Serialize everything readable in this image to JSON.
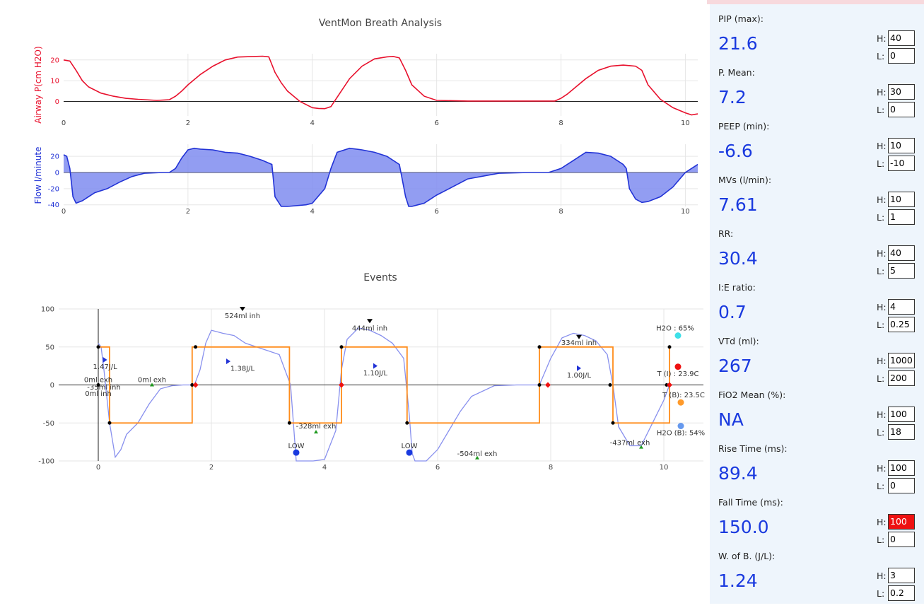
{
  "chart_data": [
    {
      "type": "line",
      "title": "VentMon Breath Analysis",
      "ylabel": "Airway P(cm H2O)",
      "xlim": [
        0,
        10.2
      ],
      "ylim": [
        -7,
        23
      ],
      "xticks": [
        0,
        2,
        4,
        6,
        8,
        10
      ],
      "yticks": [
        0,
        10,
        20
      ],
      "color": "#e8112d",
      "x": [
        0,
        0.1,
        0.2,
        0.3,
        0.4,
        0.6,
        0.8,
        1.0,
        1.2,
        1.5,
        1.7,
        1.8,
        1.9,
        2.0,
        2.2,
        2.4,
        2.6,
        2.8,
        3.0,
        3.2,
        3.3,
        3.4,
        3.5,
        3.6,
        3.8,
        4.0,
        4.1,
        4.2,
        4.3,
        4.4,
        4.6,
        4.8,
        5.0,
        5.2,
        5.3,
        5.4,
        5.5,
        5.6,
        5.8,
        6.0,
        6.5,
        7.0,
        7.5,
        7.9,
        8.0,
        8.1,
        8.2,
        8.4,
        8.6,
        8.8,
        9.0,
        9.2,
        9.3,
        9.4,
        9.6,
        9.8,
        10.0,
        10.1,
        10.2
      ],
      "y": [
        20,
        19.5,
        15,
        10,
        7,
        4,
        2.5,
        1.5,
        1,
        0.5,
        0.8,
        2.5,
        5,
        8,
        13,
        17,
        20,
        21.4,
        21.6,
        21.8,
        21.5,
        14,
        9,
        5,
        0,
        -3,
        -3.4,
        -3.5,
        -2.5,
        2,
        11,
        17,
        20.5,
        21.5,
        21.7,
        21,
        15,
        8,
        2.5,
        0.5,
        0.2,
        0.2,
        0.2,
        0.2,
        1.5,
        3.5,
        6,
        11,
        15,
        17,
        17.5,
        17,
        15,
        8,
        1,
        -3,
        -5.5,
        -6.5,
        -6
      ]
    },
    {
      "type": "area",
      "ylabel": "Flow l/minute",
      "xlim": [
        0,
        10.2
      ],
      "ylim": [
        -42,
        35
      ],
      "xticks": [
        0,
        2,
        4,
        6,
        8,
        10
      ],
      "yticks": [
        -40,
        -20,
        0,
        20
      ],
      "color": "#2233d6",
      "x": [
        0,
        0.05,
        0.1,
        0.15,
        0.2,
        0.3,
        0.5,
        0.7,
        0.9,
        1.1,
        1.3,
        1.6,
        1.7,
        1.8,
        1.9,
        2.0,
        2.1,
        2.2,
        2.4,
        2.6,
        2.8,
        3.0,
        3.2,
        3.35,
        3.4,
        3.5,
        3.6,
        3.9,
        4.0,
        4.2,
        4.3,
        4.4,
        4.6,
        4.8,
        5.0,
        5.2,
        5.4,
        5.5,
        5.55,
        5.6,
        5.7,
        5.8,
        6.0,
        6.2,
        6.5,
        7.0,
        7.5,
        7.8,
        8.0,
        8.2,
        8.4,
        8.6,
        8.8,
        9.0,
        9.05,
        9.1,
        9.2,
        9.3,
        9.4,
        9.6,
        9.8,
        10.0,
        10.2
      ],
      "y": [
        22,
        20,
        5,
        -30,
        -38,
        -35,
        -25,
        -20,
        -12,
        -5,
        -1,
        0,
        0,
        5,
        18,
        28,
        30,
        29,
        28,
        25,
        24,
        20,
        15,
        10,
        -30,
        -42,
        -42,
        -40,
        -38,
        -20,
        5,
        25,
        30,
        28,
        25,
        20,
        10,
        -30,
        -42,
        -42,
        -40,
        -38,
        -28,
        -20,
        -8,
        -1,
        0,
        0,
        5,
        15,
        25,
        24,
        20,
        10,
        5,
        -20,
        -33,
        -37,
        -36,
        -30,
        -18,
        0,
        10
      ]
    },
    {
      "type": "scatter",
      "title": "Events",
      "xlim": [
        -0.7,
        10.7
      ],
      "ylim": [
        -100,
        100
      ],
      "xticks": [
        0,
        2,
        4,
        6,
        8,
        10
      ],
      "yticks": [
        -100,
        -50,
        0,
        50,
        100
      ],
      "series": [
        {
          "color": "#8890ee",
          "x": [
            0,
            0.05,
            0.1,
            0.2,
            0.3,
            0.4,
            0.5,
            0.7,
            0.9,
            1.1,
            1.3,
            1.5,
            1.7,
            1.8,
            1.9,
            2.0,
            2.2,
            2.4,
            2.6,
            2.8,
            3.0,
            3.2,
            3.4,
            3.5,
            3.6,
            3.8,
            4.0,
            4.2,
            4.3,
            4.4,
            4.6,
            4.8,
            5.0,
            5.2,
            5.4,
            5.5,
            5.55,
            5.6,
            5.8,
            6.0,
            6.2,
            6.4,
            6.6,
            7.0,
            7.4,
            7.8,
            8.0,
            8.2,
            8.4,
            8.6,
            8.8,
            9.0,
            9.1,
            9.2,
            9.4,
            9.6,
            9.8,
            10.0,
            10.1
          ],
          "y": [
            55,
            50,
            20,
            -50,
            -95,
            -85,
            -65,
            -50,
            -25,
            -5,
            -1,
            0,
            0,
            20,
            55,
            72,
            68,
            65,
            55,
            50,
            45,
            40,
            0,
            -100,
            -100,
            -100,
            -98,
            -60,
            20,
            60,
            75,
            72,
            65,
            55,
            35,
            -40,
            -90,
            -100,
            -100,
            -85,
            -60,
            -35,
            -15,
            -1,
            0,
            0,
            35,
            62,
            68,
            65,
            58,
            40,
            0,
            -55,
            -80,
            -80,
            -50,
            -20,
            0
          ]
        },
        {
          "color": "#ff8c1a",
          "x": [
            0,
            0.2,
            0.2,
            1.66,
            1.66,
            3.38,
            3.38,
            4.3,
            4.3,
            5.46,
            5.46,
            7.8,
            7.8,
            9.1,
            9.1,
            10.1,
            10.1
          ],
          "y": [
            50,
            50,
            -50,
            -50,
            50,
            50,
            -50,
            -50,
            50,
            50,
            -50,
            -50,
            50,
            50,
            -50,
            -50,
            50
          ]
        }
      ],
      "labels": [
        {
          "text": "524ml inh",
          "x": 2.55,
          "y": 91
        },
        {
          "text": "444ml inh",
          "x": 4.8,
          "y": 75
        },
        {
          "text": "334ml inh",
          "x": 8.5,
          "y": 56
        },
        {
          "text": "1.47J/L",
          "x": 0.12,
          "y": 24
        },
        {
          "text": "1.38J/L",
          "x": 2.55,
          "y": 22
        },
        {
          "text": "1.10J/L",
          "x": 4.9,
          "y": 16
        },
        {
          "text": "1.00J/L",
          "x": 8.5,
          "y": 13
        },
        {
          "text": "0ml exh",
          "x": 0,
          "y": 7
        },
        {
          "text": "0ml exh",
          "x": 0.95,
          "y": 7
        },
        {
          "text": "-35ml inh",
          "x": 0.1,
          "y": -3
        },
        {
          "text": "0ml inh",
          "x": 0,
          "y": -11
        },
        {
          "text": "-328ml exh",
          "x": 3.85,
          "y": -54
        },
        {
          "text": "-504ml exh",
          "x": 6.7,
          "y": -90
        },
        {
          "text": "-437ml exh",
          "x": 9.4,
          "y": -76
        },
        {
          "text": "LOW",
          "x": 3.5,
          "y": -80
        },
        {
          "text": "LOW",
          "x": 5.5,
          "y": -80
        },
        {
          "text": "H2O : 65%",
          "x": 10.2,
          "y": 75
        },
        {
          "text": "T (I) : 23.9C",
          "x": 10.25,
          "y": 15
        },
        {
          "text": "T (B): 23.5C",
          "x": 10.35,
          "y": -13
        },
        {
          "text": "H2O (B): 54%",
          "x": 10.3,
          "y": -63
        }
      ],
      "markers": [
        {
          "shape": "tri-down",
          "color": "#000000",
          "x": 2.55,
          "y": 100
        },
        {
          "shape": "tri-down",
          "color": "#000000",
          "x": 4.8,
          "y": 84
        },
        {
          "shape": "tri-down",
          "color": "#000000",
          "x": 8.5,
          "y": 63
        },
        {
          "shape": "tri-right",
          "color": "#2233d6",
          "x": 0.12,
          "y": 33
        },
        {
          "shape": "tri-right",
          "color": "#2233d6",
          "x": 2.3,
          "y": 31
        },
        {
          "shape": "tri-right",
          "color": "#2233d6",
          "x": 4.9,
          "y": 25
        },
        {
          "shape": "tri-right",
          "color": "#2233d6",
          "x": 8.5,
          "y": 22
        },
        {
          "shape": "tri-up",
          "color": "#1f9a1f",
          "x": 0.95,
          "y": 0
        },
        {
          "shape": "tri-up",
          "color": "#1f9a1f",
          "x": 3.85,
          "y": -62
        },
        {
          "shape": "tri-up",
          "color": "#1f9a1f",
          "x": 6.7,
          "y": -96
        },
        {
          "shape": "tri-up",
          "color": "#1f9a1f",
          "x": 9.6,
          "y": -82
        },
        {
          "shape": "dot",
          "color": "#1a3adf",
          "x": 3.5,
          "y": -89
        },
        {
          "shape": "dot",
          "color": "#1a3adf",
          "x": 5.5,
          "y": -89
        },
        {
          "shape": "dot",
          "color": "#3ee0e8",
          "x": 10.25,
          "y": 65
        },
        {
          "shape": "dot",
          "color": "#ee1111",
          "x": 10.25,
          "y": 24
        },
        {
          "shape": "dot",
          "color": "#ff9a2a",
          "x": 10.3,
          "y": -23
        },
        {
          "shape": "dot",
          "color": "#6699ee",
          "x": 10.3,
          "y": -54
        },
        {
          "shape": "small",
          "color": "#000000",
          "x": 0,
          "y": 50
        },
        {
          "shape": "small",
          "color": "#000000",
          "x": 0.2,
          "y": -50
        },
        {
          "shape": "small",
          "color": "#000000",
          "x": 1.66,
          "y": 0
        },
        {
          "shape": "small",
          "color": "#000000",
          "x": 1.72,
          "y": 50
        },
        {
          "shape": "small",
          "color": "#000000",
          "x": 3.38,
          "y": -50
        },
        {
          "shape": "small",
          "color": "#000000",
          "x": 4.3,
          "y": 50
        },
        {
          "shape": "small",
          "color": "#000000",
          "x": 5.46,
          "y": -50
        },
        {
          "shape": "small",
          "color": "#000000",
          "x": 7.8,
          "y": 0
        },
        {
          "shape": "small",
          "color": "#000000",
          "x": 7.8,
          "y": 50
        },
        {
          "shape": "small",
          "color": "#000000",
          "x": 9.05,
          "y": 0
        },
        {
          "shape": "small",
          "color": "#000000",
          "x": 9.1,
          "y": -50
        },
        {
          "shape": "small",
          "color": "#000000",
          "x": 10.05,
          "y": 0
        },
        {
          "shape": "small",
          "color": "#000000",
          "x": 10.1,
          "y": 50
        },
        {
          "shape": "small",
          "color": "#000000",
          "x": 0,
          "y": 0
        },
        {
          "shape": "diamond",
          "color": "#ee1111",
          "x": 1.72,
          "y": 0
        },
        {
          "shape": "diamond",
          "color": "#ee1111",
          "x": 4.3,
          "y": 0
        },
        {
          "shape": "diamond",
          "color": "#ee1111",
          "x": 7.95,
          "y": 0
        },
        {
          "shape": "diamond",
          "color": "#ee1111",
          "x": 10.1,
          "y": 0
        }
      ]
    }
  ],
  "panel": {
    "metrics": [
      {
        "label": "PIP (max):",
        "value": "21.6",
        "h": "40",
        "l": "0",
        "h_alarm": false
      },
      {
        "label": "P. Mean:",
        "value": "7.2",
        "h": "30",
        "l": "0",
        "h_alarm": false
      },
      {
        "label": "PEEP (min):",
        "value": "-6.6",
        "h": "10",
        "l": "-10",
        "h_alarm": false
      },
      {
        "label": "MVs (l/min):",
        "value": "7.61",
        "h": "10",
        "l": "1",
        "h_alarm": false
      },
      {
        "label": "RR:",
        "value": "30.4",
        "h": "40",
        "l": "5",
        "h_alarm": false
      },
      {
        "label": "I:E ratio:",
        "value": "0.7",
        "h": "4",
        "l": "0.25",
        "h_alarm": false
      },
      {
        "label": "VTd (ml):",
        "value": "267",
        "h": "1000",
        "l": "200",
        "h_alarm": false
      },
      {
        "label": "FiO2 Mean (%):",
        "value": "NA",
        "h": "100",
        "l": "18",
        "h_alarm": false
      },
      {
        "label": "Rise Time (ms):",
        "value": "89.4",
        "h": "100",
        "l": "0",
        "h_alarm": false
      },
      {
        "label": "Fall Time (ms):",
        "value": "150.0",
        "h": "100",
        "l": "0",
        "h_alarm": true
      },
      {
        "label": "W. of B. (J/L):",
        "value": "1.24",
        "h": "3",
        "l": "0.2",
        "h_alarm": false
      }
    ],
    "h_label": "H:",
    "l_label": "L:"
  }
}
